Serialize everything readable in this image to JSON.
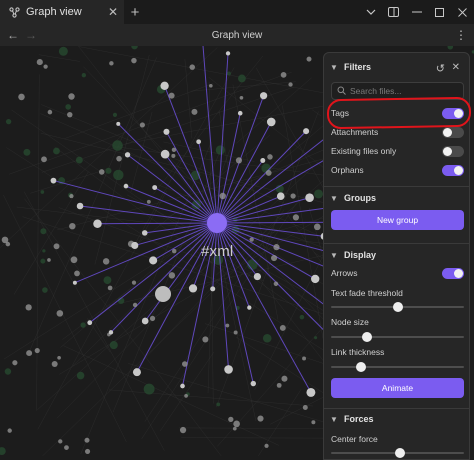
{
  "window": {
    "tab_title": "Graph view",
    "tab_icon": "graph-icon",
    "new_tab_label": "+",
    "close_tab_label": "✕",
    "controls": [
      "chevron-down-icon",
      "sidebar-icon",
      "minimize-icon",
      "maximize-icon",
      "close-icon"
    ]
  },
  "header": {
    "title": "Graph view",
    "back_label": "←",
    "forward_label": "→",
    "more_label": "⋮"
  },
  "graph": {
    "center_label": "#xml",
    "colors": {
      "node": "#c8c8c8",
      "center": "#8b6cf4",
      "link": "#6b4fd8",
      "background_node": "#274a30"
    }
  },
  "panel": {
    "filters": {
      "title": "Filters",
      "search_placeholder": "Search files...",
      "toggles": [
        {
          "label": "Tags",
          "on": true
        },
        {
          "label": "Attachments",
          "on": false
        },
        {
          "label": "Existing files only",
          "on": false
        },
        {
          "label": "Orphans",
          "on": true
        }
      ]
    },
    "groups": {
      "title": "Groups",
      "button_label": "New group"
    },
    "display": {
      "title": "Display",
      "arrows_label": "Arrows",
      "arrows_on": true,
      "text_fade_label": "Text fade threshold",
      "text_fade_value": 0.5,
      "node_size_label": "Node size",
      "node_size_value": 0.25,
      "link_thickness_label": "Link thickness",
      "link_thickness_value": 0.2,
      "animate_label": "Animate"
    },
    "forces": {
      "title": "Forces",
      "center_force_label": "Center force",
      "center_force_value": 0.52
    }
  },
  "accent_color": "#7b5cf0",
  "annotation_color": "#e0141b"
}
